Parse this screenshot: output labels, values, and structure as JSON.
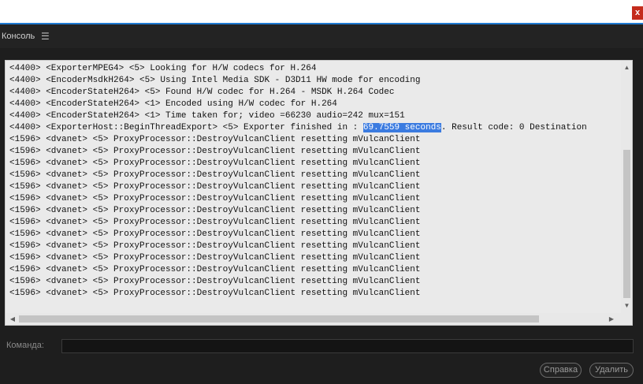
{
  "window": {
    "close_glyph": "x"
  },
  "panel": {
    "title": "Консоль",
    "menu_glyph": "☰"
  },
  "console": {
    "lines": [
      {
        "text": "<4400> <ExporterMPEG4> <5> Looking for H/W codecs for H.264"
      },
      {
        "text": "<4400> <EncoderMsdkH264> <5> Using Intel Media SDK - D3D11 HW mode for encoding"
      },
      {
        "text": "<4400> <EncoderStateH264> <5> Found H/W codec for H.264 - MSDK H.264 Codec"
      },
      {
        "text": "<4400> <EncoderStateH264> <1> Encoded using H/W codec for H.264"
      },
      {
        "text": "<4400> <EncoderStateH264> <1> Time taken for; video =66230 audio=242 mux=151"
      },
      {
        "text": "<4400> <ExporterHost::BeginThreadExport> <5> Exporter finished in : ",
        "selected": "69.7559 seconds",
        "after": ". Result code: 0 Destination"
      },
      {
        "text": "<1596> <dvanet> <5> ProxyProcessor::DestroyVulcanClient resetting mVulcanClient"
      },
      {
        "text": "<1596> <dvanet> <5> ProxyProcessor::DestroyVulcanClient resetting mVulcanClient"
      },
      {
        "text": "<1596> <dvanet> <5> ProxyProcessor::DestroyVulcanClient resetting mVulcanClient"
      },
      {
        "text": "<1596> <dvanet> <5> ProxyProcessor::DestroyVulcanClient resetting mVulcanClient"
      },
      {
        "text": "<1596> <dvanet> <5> ProxyProcessor::DestroyVulcanClient resetting mVulcanClient"
      },
      {
        "text": "<1596> <dvanet> <5> ProxyProcessor::DestroyVulcanClient resetting mVulcanClient"
      },
      {
        "text": "<1596> <dvanet> <5> ProxyProcessor::DestroyVulcanClient resetting mVulcanClient"
      },
      {
        "text": "<1596> <dvanet> <5> ProxyProcessor::DestroyVulcanClient resetting mVulcanClient"
      },
      {
        "text": "<1596> <dvanet> <5> ProxyProcessor::DestroyVulcanClient resetting mVulcanClient"
      },
      {
        "text": "<1596> <dvanet> <5> ProxyProcessor::DestroyVulcanClient resetting mVulcanClient"
      },
      {
        "text": "<1596> <dvanet> <5> ProxyProcessor::DestroyVulcanClient resetting mVulcanClient"
      },
      {
        "text": "<1596> <dvanet> <5> ProxyProcessor::DestroyVulcanClient resetting mVulcanClient"
      },
      {
        "text": "<1596> <dvanet> <5> ProxyProcessor::DestroyVulcanClient resetting mVulcanClient"
      },
      {
        "text": "<1596> <dvanet> <5> ProxyProcessor::DestroyVulcanClient resetting mVulcanClient"
      }
    ]
  },
  "command": {
    "label": "Команда:",
    "value": ""
  },
  "buttons": {
    "help_label": "Справка",
    "delete_label": "Удалить"
  },
  "colors": {
    "accent": "#1f7ad2",
    "close": "#c42b1c",
    "selection": "#3b7be0"
  }
}
